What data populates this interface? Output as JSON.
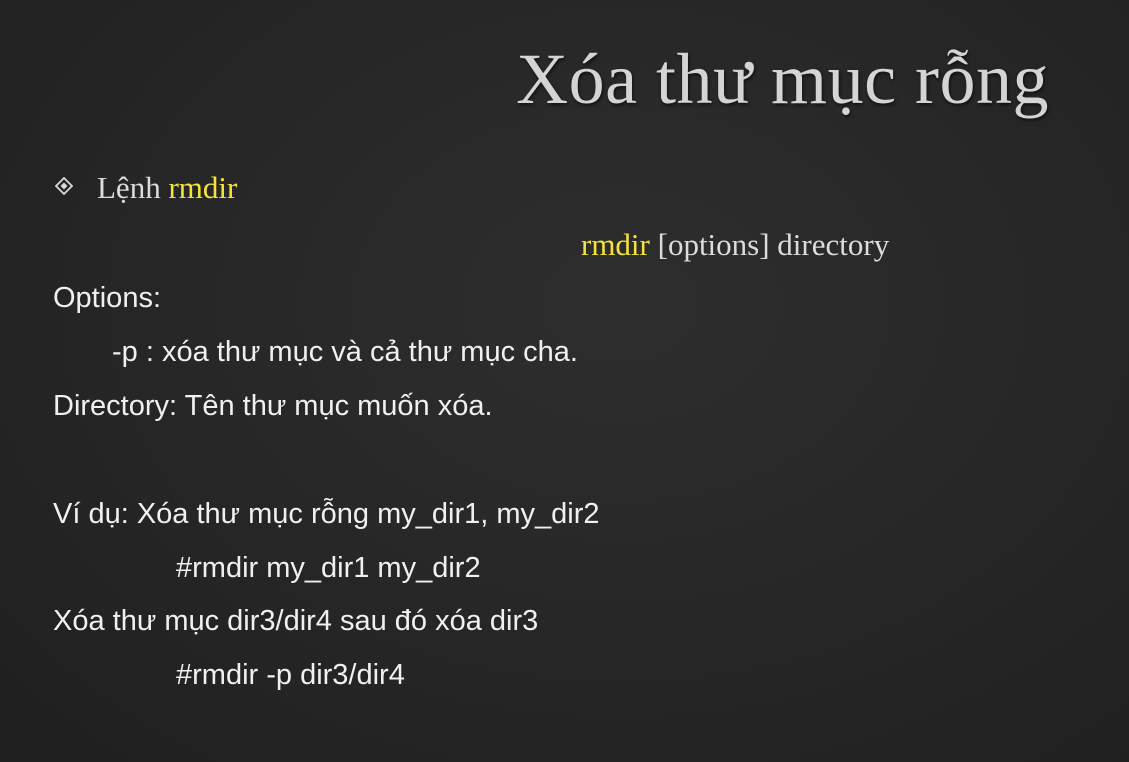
{
  "title": "Xóa thư mục rỗng",
  "bullet": {
    "icon": "diamond-bullet-icon",
    "label": "Lệnh",
    "command": "rmdir"
  },
  "syntax": {
    "command": "rmdir",
    "rest": "[options] directory"
  },
  "lines": [
    "Options:",
    "-p : xóa thư mục và cả thư mục cha.",
    "Directory: Tên thư mục muốn xóa.",
    "Ví dụ: Xóa thư mục rỗng my_dir1, my_dir2",
    "#rmdir my_dir1 my_dir2",
    "Xóa thư mục dir3/dir4 sau đó xóa dir3",
    "#rmdir -p dir3/dir4"
  ],
  "colors": {
    "background": "#262626",
    "text": "#f0f0f0",
    "highlight": "#f4e33a"
  }
}
